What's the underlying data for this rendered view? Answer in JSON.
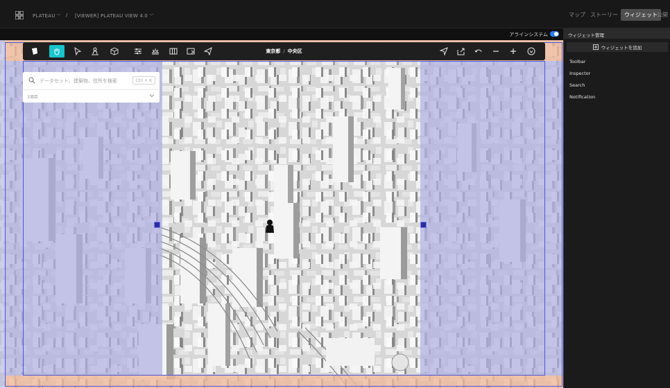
{
  "app": {
    "project_name": "PLATEAU",
    "breadcrumb_separator": "/",
    "scene_name": "[VIEWER] PLATEAU VIEW 4.0",
    "nav": [
      {
        "label": "マップ"
      },
      {
        "label": "ストーリー"
      },
      {
        "label": "ウィジェット"
      },
      {
        "label": "公開"
      }
    ]
  },
  "subbar": {
    "align_system_label": "アラインシステム",
    "align_system_enabled": true
  },
  "toolbar": {
    "icons": [
      "logo-icon",
      "hand-icon",
      "pointer-icon",
      "pedestrian-icon",
      "cube-icon",
      "sliders-icon",
      "sun-icon",
      "columns-icon",
      "screen-icon",
      "send-icon"
    ],
    "location_prefecture": "東京都",
    "location_separator": "/",
    "location_ward": "中央区",
    "right_icons": [
      "navigate-icon",
      "share-icon",
      "undo-icon",
      "zoom-out-icon",
      "zoom-in-icon",
      "compass-icon"
    ]
  },
  "search": {
    "placeholder": "データセット、建築物、住所を検索",
    "shortcut": "Ctrl + K",
    "result_count": "3項目"
  },
  "sidebar": {
    "manager_label": "ウィジェット管理",
    "add_widget_label": "ウィジェットを追加",
    "items": [
      {
        "label": "Toolbar"
      },
      {
        "label": "Inspector"
      },
      {
        "label": "Search"
      },
      {
        "label": "Notification"
      }
    ]
  },
  "colors": {
    "accent": "#19c4cc",
    "toggle": "#2a7cf0",
    "frame": "#4a55d8",
    "overlay_lavender": "#aeb0e0",
    "overlay_peach": "#f0b89a"
  }
}
